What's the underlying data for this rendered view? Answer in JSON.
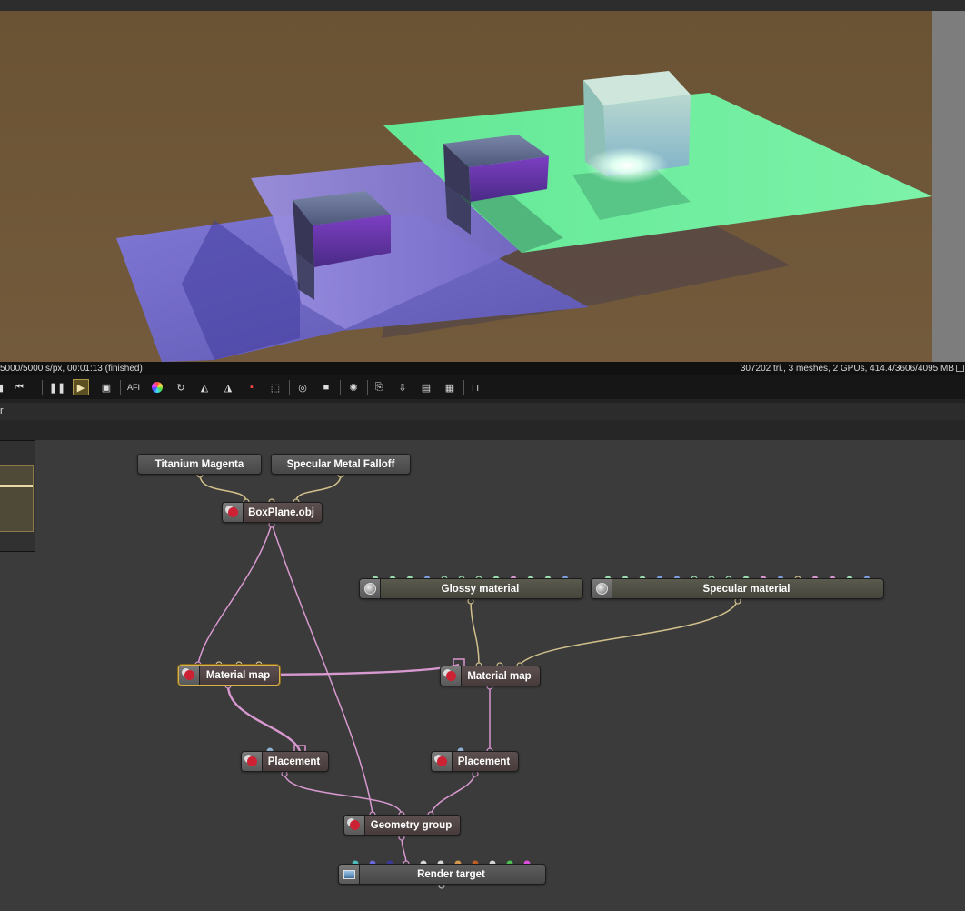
{
  "status": {
    "left": "5000/5000 s/px, 00:01:13 (finished)",
    "right": "307202 tri., 3 meshes, 2 GPUs, 414.4/3606/4095 MB"
  },
  "toolbar": {
    "pause_label": "❚❚",
    "restart_label": "⏮",
    "play_label": "▶",
    "afi_label": "AFI"
  },
  "tab": {
    "label": "r"
  },
  "nodes": {
    "titanium_magenta": "Titanium Magenta",
    "specular_metal_falloff": "Specular Metal Falloff",
    "boxplane": "BoxPlane.obj",
    "glossy_material": "Glossy material",
    "specular_material": "Specular material",
    "material_map_left": "Material map",
    "material_map_right": "Material map",
    "placement_left": "Placement",
    "placement_right": "Placement",
    "geometry_group": "Geometry group",
    "render_target": "Render target"
  },
  "colors": {
    "wire_tan": "#d2c08c",
    "wire_pink": "#d898d0",
    "selection": "#d8b24a",
    "floor": "#6b5437",
    "green_plane": "#5fe391",
    "purple_plane": "#8b7fd6"
  },
  "icons": {
    "mesh": "mesh-node-icon",
    "material": "material-sphere-icon",
    "placement": "placement-node-icon",
    "render_target": "render-target-icon"
  }
}
